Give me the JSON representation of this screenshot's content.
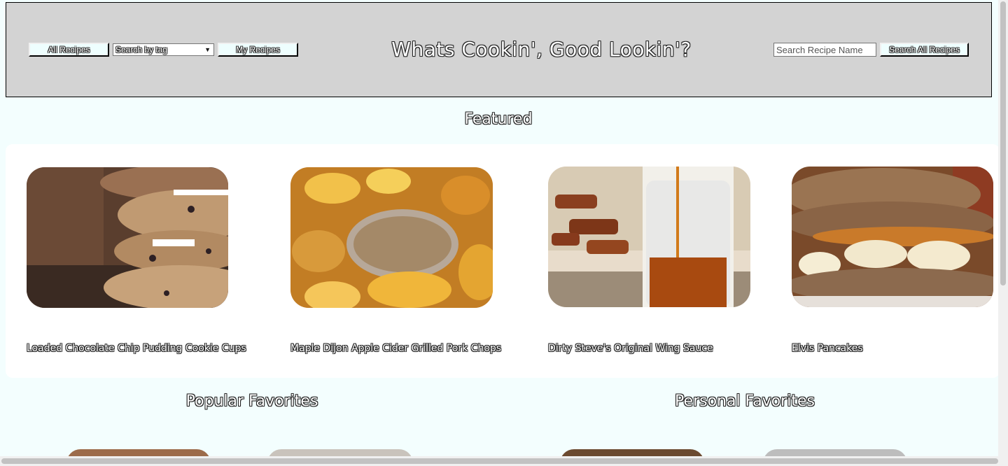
{
  "header": {
    "title": "Whats Cookin', Good Lookin'?",
    "all_recipes_label": "All Recipes",
    "tag_select_value": "Search by tag",
    "my_recipes_label": "My Recipes",
    "search_placeholder": "Search Recipe Name",
    "search_all_label": "Search All Recipes"
  },
  "featured": {
    "title": "Featured",
    "recipes": [
      {
        "name": "Loaded Chocolate Chip Pudding Cookie Cups"
      },
      {
        "name": "Maple Dijon Apple Cider Grilled Pork Chops"
      },
      {
        "name": "Dirty Steve's Original Wing Sauce"
      },
      {
        "name": "Elvis Pancakes"
      }
    ]
  },
  "popular": {
    "title": "Popular Favorites"
  },
  "personal": {
    "title": "Personal Favorites"
  },
  "colors": {
    "page_bg": "#f3fefe",
    "header_bg": "#d3d3d3",
    "panel_bg": "#ffffff"
  }
}
